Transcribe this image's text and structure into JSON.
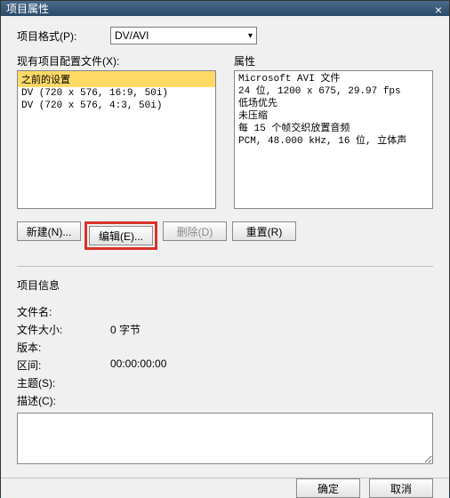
{
  "titlebar": {
    "title": "项目属性"
  },
  "labels": {
    "format": "项目格式(P):",
    "existing": "现有项目配置文件(X):",
    "properties": "属性",
    "project_info": "项目信息",
    "filename": "文件名:",
    "filesize": "文件大小:",
    "version": "版本:",
    "range": "区间:",
    "subject": "主题(S):",
    "desc": "描述(C):"
  },
  "combo": {
    "value": "DV/AVI"
  },
  "list": {
    "items": [
      {
        "text": "之前的设置",
        "selected": true
      },
      {
        "text": "DV (720 x 576, 16:9, 50i)",
        "selected": false
      },
      {
        "text": "DV (720 x 576, 4:3, 50i)",
        "selected": false
      }
    ]
  },
  "props": {
    "lines": [
      "Microsoft AVI 文件",
      "24 位, 1200 x 675, 29.97 fps",
      "低场优先",
      "未压缩",
      "每 15 个帧交织放置音频",
      "PCM, 48.000 kHz, 16 位, 立体声"
    ]
  },
  "buttons": {
    "new": "新建(N)...",
    "edit": "编辑(E)...",
    "delete": "删除(D)",
    "reset": "重置(R)",
    "ok": "确定",
    "cancel": "取消"
  },
  "info": {
    "filename": "",
    "filesize": "0 字节",
    "version": "",
    "range": "00:00:00:00",
    "subject": "",
    "desc": ""
  }
}
